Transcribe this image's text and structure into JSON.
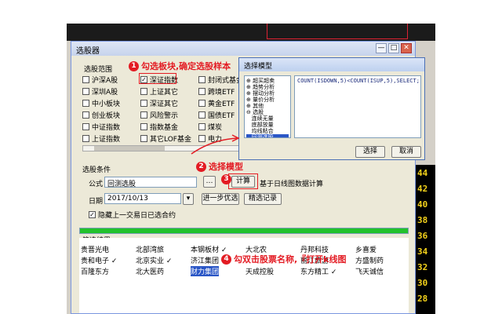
{
  "window": {
    "title": "选股器",
    "min": "—",
    "max": "□",
    "close": "✕"
  },
  "scope": {
    "label": "选股范围",
    "checks": [
      {
        "label": "沪深A股",
        "checked": false
      },
      {
        "label": "深证指数",
        "checked": true
      },
      {
        "label": "封闭式基金",
        "checked": false
      },
      {
        "label": "深圳A股",
        "checked": false
      },
      {
        "label": "上证其它",
        "checked": false
      },
      {
        "label": "跨境ETF",
        "checked": false
      },
      {
        "label": "中小板块",
        "checked": false
      },
      {
        "label": "深证其它",
        "checked": false
      },
      {
        "label": "黄金ETF",
        "checked": false
      },
      {
        "label": "创业板块",
        "checked": false
      },
      {
        "label": "风险警示",
        "checked": false
      },
      {
        "label": "国债ETF",
        "checked": false
      },
      {
        "label": "中证指数",
        "checked": false
      },
      {
        "label": "指数基金",
        "checked": false
      },
      {
        "label": "煤炭",
        "checked": false
      },
      {
        "label": "上证指数",
        "checked": false
      },
      {
        "label": "其它LOF基金",
        "checked": false
      },
      {
        "label": "电力",
        "checked": false
      }
    ]
  },
  "condition": {
    "label": "选股条件",
    "formula_label": "公式",
    "formula_value": "回测选股",
    "calc_button": "计算",
    "calc_note": "基于日线图数据计算",
    "date_label": "日期",
    "date_value": "2017/10/13",
    "step_button": "进一步优选",
    "record_button": "精选记录",
    "hide_check": "隐藏上一交易日已选合约",
    "hide_checked": true
  },
  "progress": 1.0,
  "results": {
    "label": "筛选结果",
    "rows": [
      [
        "贵晋光电",
        "北部湾旅",
        "本钢板材 ✓",
        "大北农",
        "丹邦科技",
        "乡喜爱"
      ],
      [
        "贵和电子 ✓",
        "北京实业 ✓",
        "济江集团",
        "",
        "丽江旅游",
        "方盛制药"
      ],
      [
        "百隆东方",
        "北大医药",
        "财力集团",
        "天成控股",
        "东方精工 ✓",
        "飞天诚信"
      ]
    ]
  },
  "modal": {
    "title": "选择模型",
    "tree": [
      "⊕ 超买超卖",
      "⊕ 趋势分析",
      "⊕ 摆动分析",
      "⊕ 量价分析",
      "⊕ 其他",
      "⊖ 选股",
      "   连续无量",
      "   底部放量",
      "   均线粘合",
      "   回测选股"
    ],
    "code": "COUNT(ISDOWN,5)<COUNT(ISUP,5),SELECT;",
    "ok": "选择",
    "cancel": "取消"
  },
  "annotations": {
    "a1": {
      "num": "1",
      "text": "勾选板块,确定选股样本"
    },
    "a2": {
      "num": "2",
      "text": "选择模型"
    },
    "a3": {
      "num": "3",
      "text": "计算"
    },
    "a4": {
      "num": "4",
      "text": "勾双击股票名称,『打开k线图"
    }
  },
  "sidebar_numbers": [
    "44",
    "42",
    "40",
    "38",
    "36",
    "34",
    "32",
    "30",
    "28"
  ],
  "colors": {
    "annotation": "#e31b23",
    "progress": "#22c22c",
    "sidebar_num": "#f4d21b"
  }
}
